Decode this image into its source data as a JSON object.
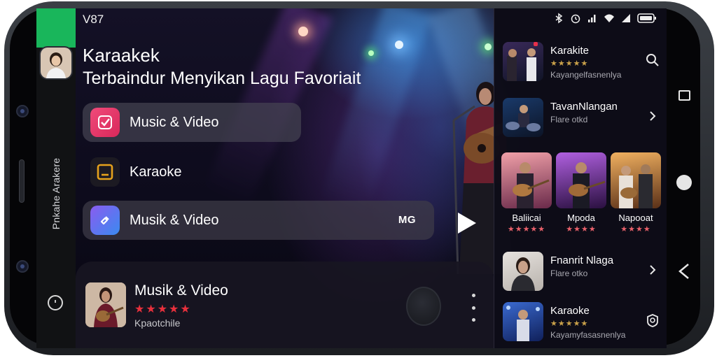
{
  "status": {
    "time": "V87"
  },
  "rail": {
    "label": "Pnkahe Arakere"
  },
  "header": {
    "title": "Karaakek",
    "subtitle": "Terbaindur Menyikan Lagu Favoriait"
  },
  "menu": [
    {
      "label": "Music & Video",
      "icon": "check-icon",
      "color": "#e8386a"
    },
    {
      "label": "Karaoke",
      "icon": "karaoke-icon",
      "color": "#e6a21c"
    },
    {
      "label": "Musik & Video",
      "icon": "link-icon",
      "color": "#5b6ef0",
      "badge": "MG"
    }
  ],
  "mini_player": {
    "title": "Musik & Video",
    "stars": "★★★★★",
    "subtitle": "Kpaotchile"
  },
  "right_panel": {
    "items_top": [
      {
        "title": "Karakite",
        "stars": "★★★★★",
        "sub": "Kayangelfasnenlya",
        "trail": "search-icon"
      },
      {
        "title": "TavanNlangan",
        "sub": "Flare otkd",
        "trail": "chevron-right-icon"
      }
    ],
    "grid": [
      {
        "name": "Baliicai",
        "stars": "★★★★★"
      },
      {
        "name": "Mpoda",
        "stars": "★★★★"
      },
      {
        "name": "Napooat",
        "stars": "★★★★"
      }
    ],
    "items_bottom": [
      {
        "title": "Fnanrit Nlaga",
        "sub": "Flare otko",
        "trail": "chevron-right-icon"
      },
      {
        "title": "Karaoke",
        "stars": "★★★★★",
        "sub": "Kayamyfasasnenlya",
        "trail": "settings-badge-icon"
      }
    ]
  },
  "colors": {
    "accent_green": "#19b65b",
    "star_red": "#e8303c",
    "star_gold": "#c9a14a"
  }
}
